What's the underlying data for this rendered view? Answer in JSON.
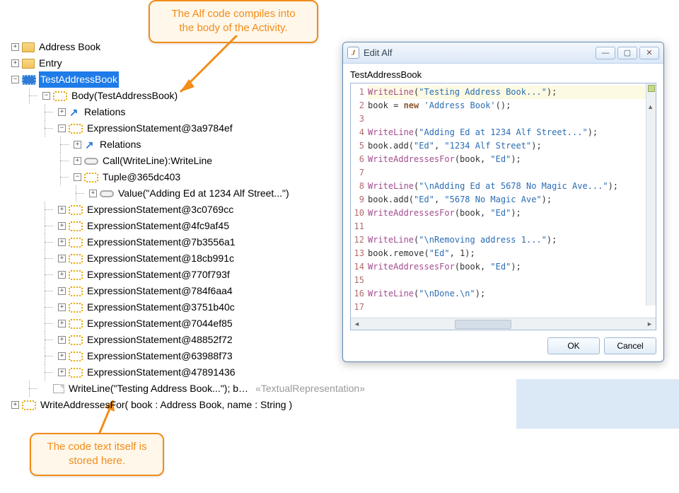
{
  "callouts": {
    "top": "The Alf code compiles into\nthe body of the Activity.",
    "bottom": "The code text itself is\nstored here."
  },
  "tree": {
    "addressBook": "Address Book",
    "entry": "Entry",
    "testAddressBook": "TestAddressBook",
    "body": "Body(TestAddressBook)",
    "relations": "Relations",
    "expr0": "ExpressionStatement@3a9784ef",
    "relations2": "Relations",
    "call": "Call(WriteLine):WriteLine",
    "tuple": "Tuple@365dc403",
    "value": "Value(\"Adding Ed at 1234 Alf Street...\")",
    "expr1": "ExpressionStatement@3c0769cc",
    "expr2": "ExpressionStatement@4fc9af45",
    "expr3": "ExpressionStatement@7b3556a1",
    "expr4": "ExpressionStatement@18cb991c",
    "expr5": "ExpressionStatement@770f793f",
    "expr6": "ExpressionStatement@784f6aa4",
    "expr7": "ExpressionStatement@3751b40c",
    "expr8": "ExpressionStatement@7044ef85",
    "expr9": "ExpressionStatement@48852f72",
    "expr10": "ExpressionStatement@63988f73",
    "expr11": "ExpressionStatement@47891436",
    "writeline": "WriteLine(\"Testing Address Book...\"); book = new '...",
    "stereotype": "«TextualRepresentation»",
    "writeAddresses": "WriteAddressesFor( book : Address Book, name : String )"
  },
  "dialog": {
    "title": "Edit Alf",
    "subject": "TestAddressBook",
    "ok": "OK",
    "cancel": "Cancel",
    "code": {
      "lines": [
        {
          "n": 1,
          "hl": true,
          "tokens": [
            {
              "t": "fn",
              "v": "WriteLine"
            },
            {
              "t": "p",
              "v": "("
            },
            {
              "t": "str",
              "v": "\"Testing Address Book...\""
            },
            {
              "t": "p",
              "v": ");"
            }
          ]
        },
        {
          "n": 2,
          "tokens": [
            {
              "t": "id",
              "v": "book = "
            },
            {
              "t": "kw",
              "v": "new"
            },
            {
              "t": "id",
              "v": " "
            },
            {
              "t": "str",
              "v": "'Address Book'"
            },
            {
              "t": "p",
              "v": "();"
            }
          ]
        },
        {
          "n": 3,
          "tokens": []
        },
        {
          "n": 4,
          "tokens": [
            {
              "t": "fn",
              "v": "WriteLine"
            },
            {
              "t": "p",
              "v": "("
            },
            {
              "t": "str",
              "v": "\"Adding Ed at 1234 Alf Street...\""
            },
            {
              "t": "p",
              "v": ");"
            }
          ]
        },
        {
          "n": 5,
          "tokens": [
            {
              "t": "id",
              "v": "book.add("
            },
            {
              "t": "str",
              "v": "\"Ed\""
            },
            {
              "t": "p",
              "v": ", "
            },
            {
              "t": "str",
              "v": "\"1234 Alf Street\""
            },
            {
              "t": "p",
              "v": ");"
            }
          ]
        },
        {
          "n": 6,
          "tokens": [
            {
              "t": "fn",
              "v": "WriteAddressesFor"
            },
            {
              "t": "p",
              "v": "(book, "
            },
            {
              "t": "str",
              "v": "\"Ed\""
            },
            {
              "t": "p",
              "v": ");"
            }
          ]
        },
        {
          "n": 7,
          "tokens": []
        },
        {
          "n": 8,
          "tokens": [
            {
              "t": "fn",
              "v": "WriteLine"
            },
            {
              "t": "p",
              "v": "("
            },
            {
              "t": "str",
              "v": "\"\\nAdding Ed at 5678 No Magic Ave...\""
            },
            {
              "t": "p",
              "v": ");"
            }
          ]
        },
        {
          "n": 9,
          "tokens": [
            {
              "t": "id",
              "v": "book.add("
            },
            {
              "t": "str",
              "v": "\"Ed\""
            },
            {
              "t": "p",
              "v": ", "
            },
            {
              "t": "str",
              "v": "\"5678 No Magic Ave\""
            },
            {
              "t": "p",
              "v": ");"
            }
          ]
        },
        {
          "n": 10,
          "tokens": [
            {
              "t": "fn",
              "v": "WriteAddressesFor"
            },
            {
              "t": "p",
              "v": "(book, "
            },
            {
              "t": "str",
              "v": "\"Ed\""
            },
            {
              "t": "p",
              "v": ");"
            }
          ]
        },
        {
          "n": 11,
          "tokens": []
        },
        {
          "n": 12,
          "tokens": [
            {
              "t": "fn",
              "v": "WriteLine"
            },
            {
              "t": "p",
              "v": "("
            },
            {
              "t": "str",
              "v": "\"\\nRemoving address 1...\""
            },
            {
              "t": "p",
              "v": ");"
            }
          ]
        },
        {
          "n": 13,
          "tokens": [
            {
              "t": "id",
              "v": "book.remove("
            },
            {
              "t": "str",
              "v": "\"Ed\""
            },
            {
              "t": "p",
              "v": ", "
            },
            {
              "t": "num",
              "v": "1"
            },
            {
              "t": "p",
              "v": ");"
            }
          ]
        },
        {
          "n": 14,
          "tokens": [
            {
              "t": "fn",
              "v": "WriteAddressesFor"
            },
            {
              "t": "p",
              "v": "(book, "
            },
            {
              "t": "str",
              "v": "\"Ed\""
            },
            {
              "t": "p",
              "v": ");"
            }
          ]
        },
        {
          "n": 15,
          "tokens": []
        },
        {
          "n": 16,
          "tokens": [
            {
              "t": "fn",
              "v": "WriteLine"
            },
            {
              "t": "p",
              "v": "("
            },
            {
              "t": "str",
              "v": "\"\\nDone.\\n\""
            },
            {
              "t": "p",
              "v": ");"
            }
          ]
        },
        {
          "n": 17,
          "tokens": []
        }
      ]
    }
  }
}
